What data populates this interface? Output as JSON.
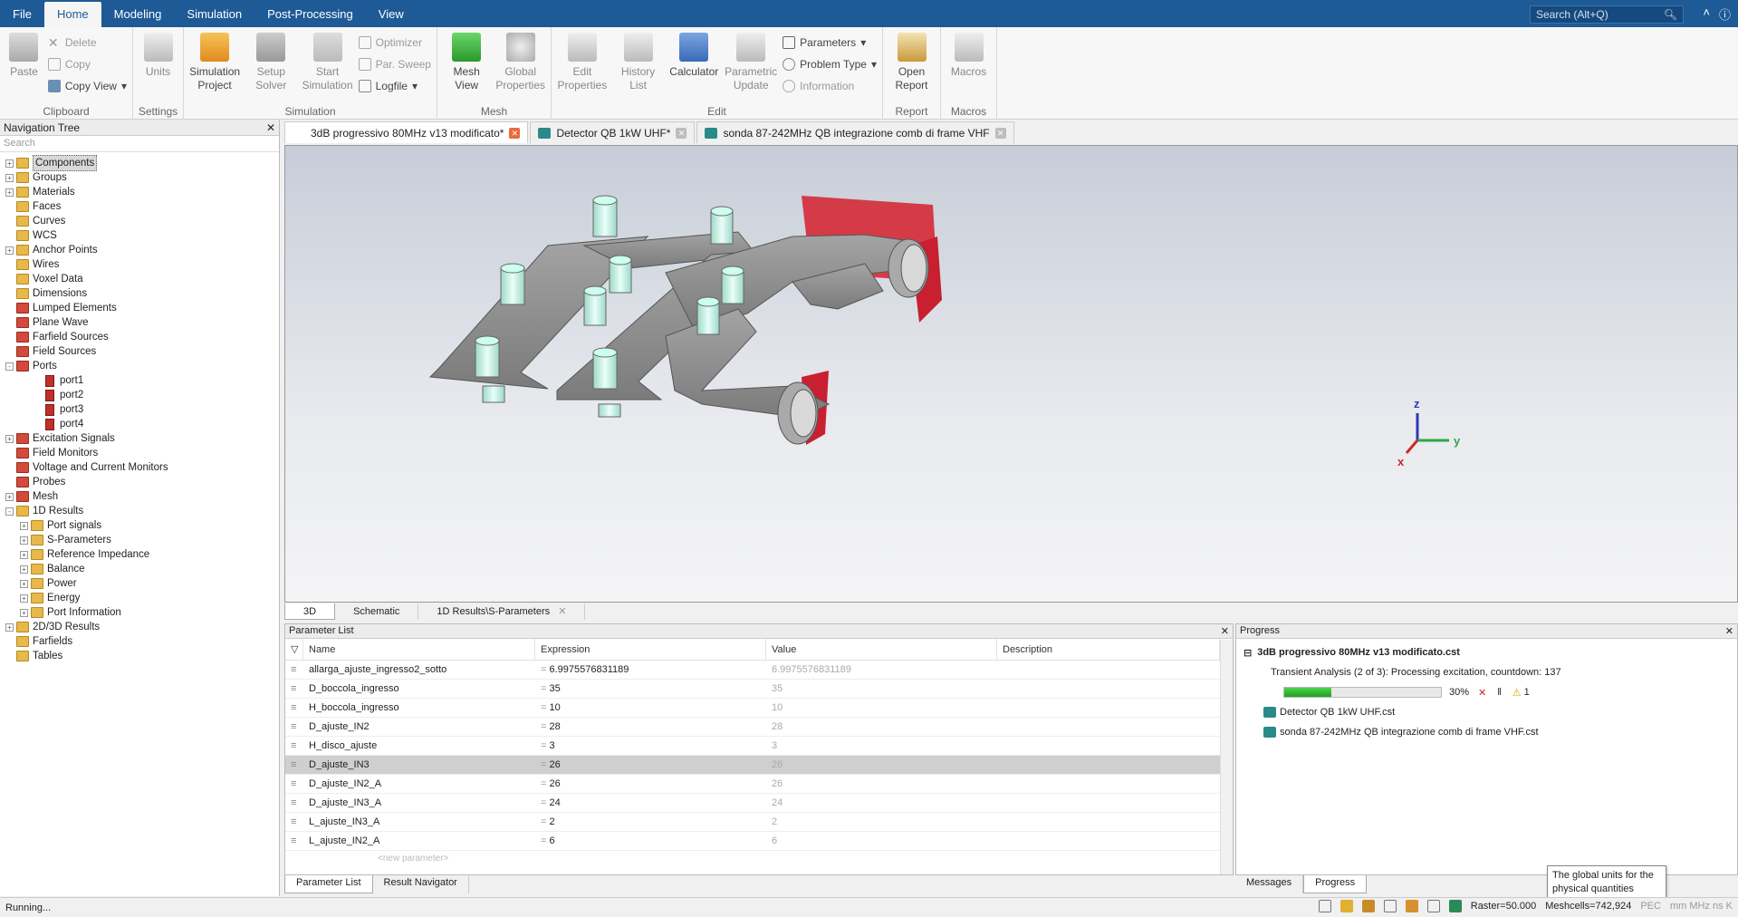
{
  "menu": {
    "items": [
      "File",
      "Home",
      "Modeling",
      "Simulation",
      "Post-Processing",
      "View"
    ],
    "active": "Home",
    "search_placeholder": "Search (Alt+Q)"
  },
  "ribbon": {
    "clipboard": {
      "paste": "Paste",
      "delete": "Delete",
      "copy": "Copy",
      "copy_view": "Copy View",
      "label": "Clipboard"
    },
    "settings": {
      "units": "Units",
      "label": "Settings"
    },
    "simulation": {
      "sim_project": "Simulation Project",
      "setup_solver": "Setup Solver",
      "start_sim": "Start Simulation",
      "optimizer": "Optimizer",
      "par_sweep": "Par. Sweep",
      "logfile": "Logfile",
      "label": "Simulation"
    },
    "mesh": {
      "mesh_view": "Mesh View",
      "global_props": "Global Properties",
      "label": "Mesh"
    },
    "edit": {
      "edit_props": "Edit Properties",
      "history": "History List",
      "calculator": "Calculator",
      "param_update": "Parametric Update",
      "parameters": "Parameters",
      "problem_type": "Problem Type",
      "information": "Information",
      "label": "Edit"
    },
    "report": {
      "open_report": "Open Report",
      "label": "Report"
    },
    "macros": {
      "macros": "Macros",
      "label": "Macros"
    }
  },
  "nav": {
    "title": "Navigation Tree",
    "search": "Search",
    "items": [
      {
        "label": "Components",
        "level": 0,
        "exp": "+",
        "icon": "folder",
        "selected": true
      },
      {
        "label": "Groups",
        "level": 0,
        "exp": "+",
        "icon": "folder"
      },
      {
        "label": "Materials",
        "level": 0,
        "exp": "+",
        "icon": "folder"
      },
      {
        "label": "Faces",
        "level": 0,
        "exp": "",
        "icon": "folder"
      },
      {
        "label": "Curves",
        "level": 0,
        "exp": "",
        "icon": "folder"
      },
      {
        "label": "WCS",
        "level": 0,
        "exp": "",
        "icon": "folder"
      },
      {
        "label": "Anchor Points",
        "level": 0,
        "exp": "+",
        "icon": "folder"
      },
      {
        "label": "Wires",
        "level": 0,
        "exp": "",
        "icon": "folder"
      },
      {
        "label": "Voxel Data",
        "level": 0,
        "exp": "",
        "icon": "folder"
      },
      {
        "label": "Dimensions",
        "level": 0,
        "exp": "",
        "icon": "folder"
      },
      {
        "label": "Lumped Elements",
        "level": 0,
        "exp": "",
        "icon": "red"
      },
      {
        "label": "Plane Wave",
        "level": 0,
        "exp": "",
        "icon": "red"
      },
      {
        "label": "Farfield Sources",
        "level": 0,
        "exp": "",
        "icon": "red"
      },
      {
        "label": "Field Sources",
        "level": 0,
        "exp": "",
        "icon": "red"
      },
      {
        "label": "Ports",
        "level": 0,
        "exp": "-",
        "icon": "red"
      },
      {
        "label": "port1",
        "level": 2,
        "exp": "",
        "icon": "port"
      },
      {
        "label": "port2",
        "level": 2,
        "exp": "",
        "icon": "port"
      },
      {
        "label": "port3",
        "level": 2,
        "exp": "",
        "icon": "port"
      },
      {
        "label": "port4",
        "level": 2,
        "exp": "",
        "icon": "port"
      },
      {
        "label": "Excitation Signals",
        "level": 0,
        "exp": "+",
        "icon": "red"
      },
      {
        "label": "Field Monitors",
        "level": 0,
        "exp": "",
        "icon": "red"
      },
      {
        "label": "Voltage and Current Monitors",
        "level": 0,
        "exp": "",
        "icon": "red"
      },
      {
        "label": "Probes",
        "level": 0,
        "exp": "",
        "icon": "red"
      },
      {
        "label": "Mesh",
        "level": 0,
        "exp": "+",
        "icon": "red"
      },
      {
        "label": "1D Results",
        "level": 0,
        "exp": "-",
        "icon": "folder"
      },
      {
        "label": "Port signals",
        "level": 1,
        "exp": "+",
        "icon": "folder"
      },
      {
        "label": "S-Parameters",
        "level": 1,
        "exp": "+",
        "icon": "folder"
      },
      {
        "label": "Reference Impedance",
        "level": 1,
        "exp": "+",
        "icon": "folder"
      },
      {
        "label": "Balance",
        "level": 1,
        "exp": "+",
        "icon": "folder"
      },
      {
        "label": "Power",
        "level": 1,
        "exp": "+",
        "icon": "folder"
      },
      {
        "label": "Energy",
        "level": 1,
        "exp": "+",
        "icon": "folder"
      },
      {
        "label": "Port Information",
        "level": 1,
        "exp": "+",
        "icon": "folder"
      },
      {
        "label": "2D/3D Results",
        "level": 0,
        "exp": "+",
        "icon": "folder"
      },
      {
        "label": "Farfields",
        "level": 0,
        "exp": "",
        "icon": "folder"
      },
      {
        "label": "Tables",
        "level": 0,
        "exp": "",
        "icon": "folder"
      }
    ]
  },
  "doc_tabs": [
    {
      "label": "3dB progressivo 80MHz v13 modificato*",
      "active": true
    },
    {
      "label": "Detector QB 1kW UHF*",
      "active": false
    },
    {
      "label": "sonda 87-242MHz QB integrazione comb di frame VHF",
      "active": false
    }
  ],
  "view_tabs": [
    "3D",
    "Schematic",
    "1D Results\\S-Parameters"
  ],
  "axes": {
    "z": "z",
    "y": "y",
    "x": "x"
  },
  "param_list": {
    "title": "Parameter List",
    "columns": [
      "Name",
      "Expression",
      "Value",
      "Description"
    ],
    "rows": [
      {
        "name": "allarga_ajuste_ingresso2_sotto",
        "expr": "6.9975576831189",
        "value": "6.9975576831189"
      },
      {
        "name": "D_boccola_ingresso",
        "expr": "35",
        "value": "35"
      },
      {
        "name": "H_boccola_ingresso",
        "expr": "10",
        "value": "10"
      },
      {
        "name": "D_ajuste_IN2",
        "expr": "28",
        "value": "28"
      },
      {
        "name": "H_disco_ajuste",
        "expr": "3",
        "value": "3"
      },
      {
        "name": "D_ajuste_IN3",
        "expr": "26",
        "value": "26",
        "selected": true
      },
      {
        "name": "D_ajuste_IN2_A",
        "expr": "26",
        "value": "26"
      },
      {
        "name": "D_ajuste_IN3_A",
        "expr": "24",
        "value": "24"
      },
      {
        "name": "L_ajuste_IN3_A",
        "expr": "2",
        "value": "2"
      },
      {
        "name": "L_ajuste_IN2_A",
        "expr": "6",
        "value": "6"
      }
    ],
    "new_param": "<new parameter>",
    "bottom_tabs": [
      "Parameter List",
      "Result Navigator"
    ]
  },
  "progress": {
    "title": "Progress",
    "project": "3dB progressivo 80MHz v13 modificato.cst",
    "task": "Transient Analysis (2 of 3): Processing excitation, countdown: 137",
    "percent": 30,
    "percent_label": "30%",
    "warnings": "1",
    "files": [
      "Detector QB 1kW UHF.cst",
      "sonda 87-242MHz QB integrazione comb di frame VHF.cst"
    ],
    "tabs": [
      "Messages",
      "Progress"
    ]
  },
  "tooltip": "The global units for the physical quantities",
  "status": {
    "left": "Running...",
    "raster": "Raster=50.000",
    "meshcells": "Meshcells=742,924",
    "pec": "PEC",
    "units": "mm  MHz  ns  K"
  }
}
